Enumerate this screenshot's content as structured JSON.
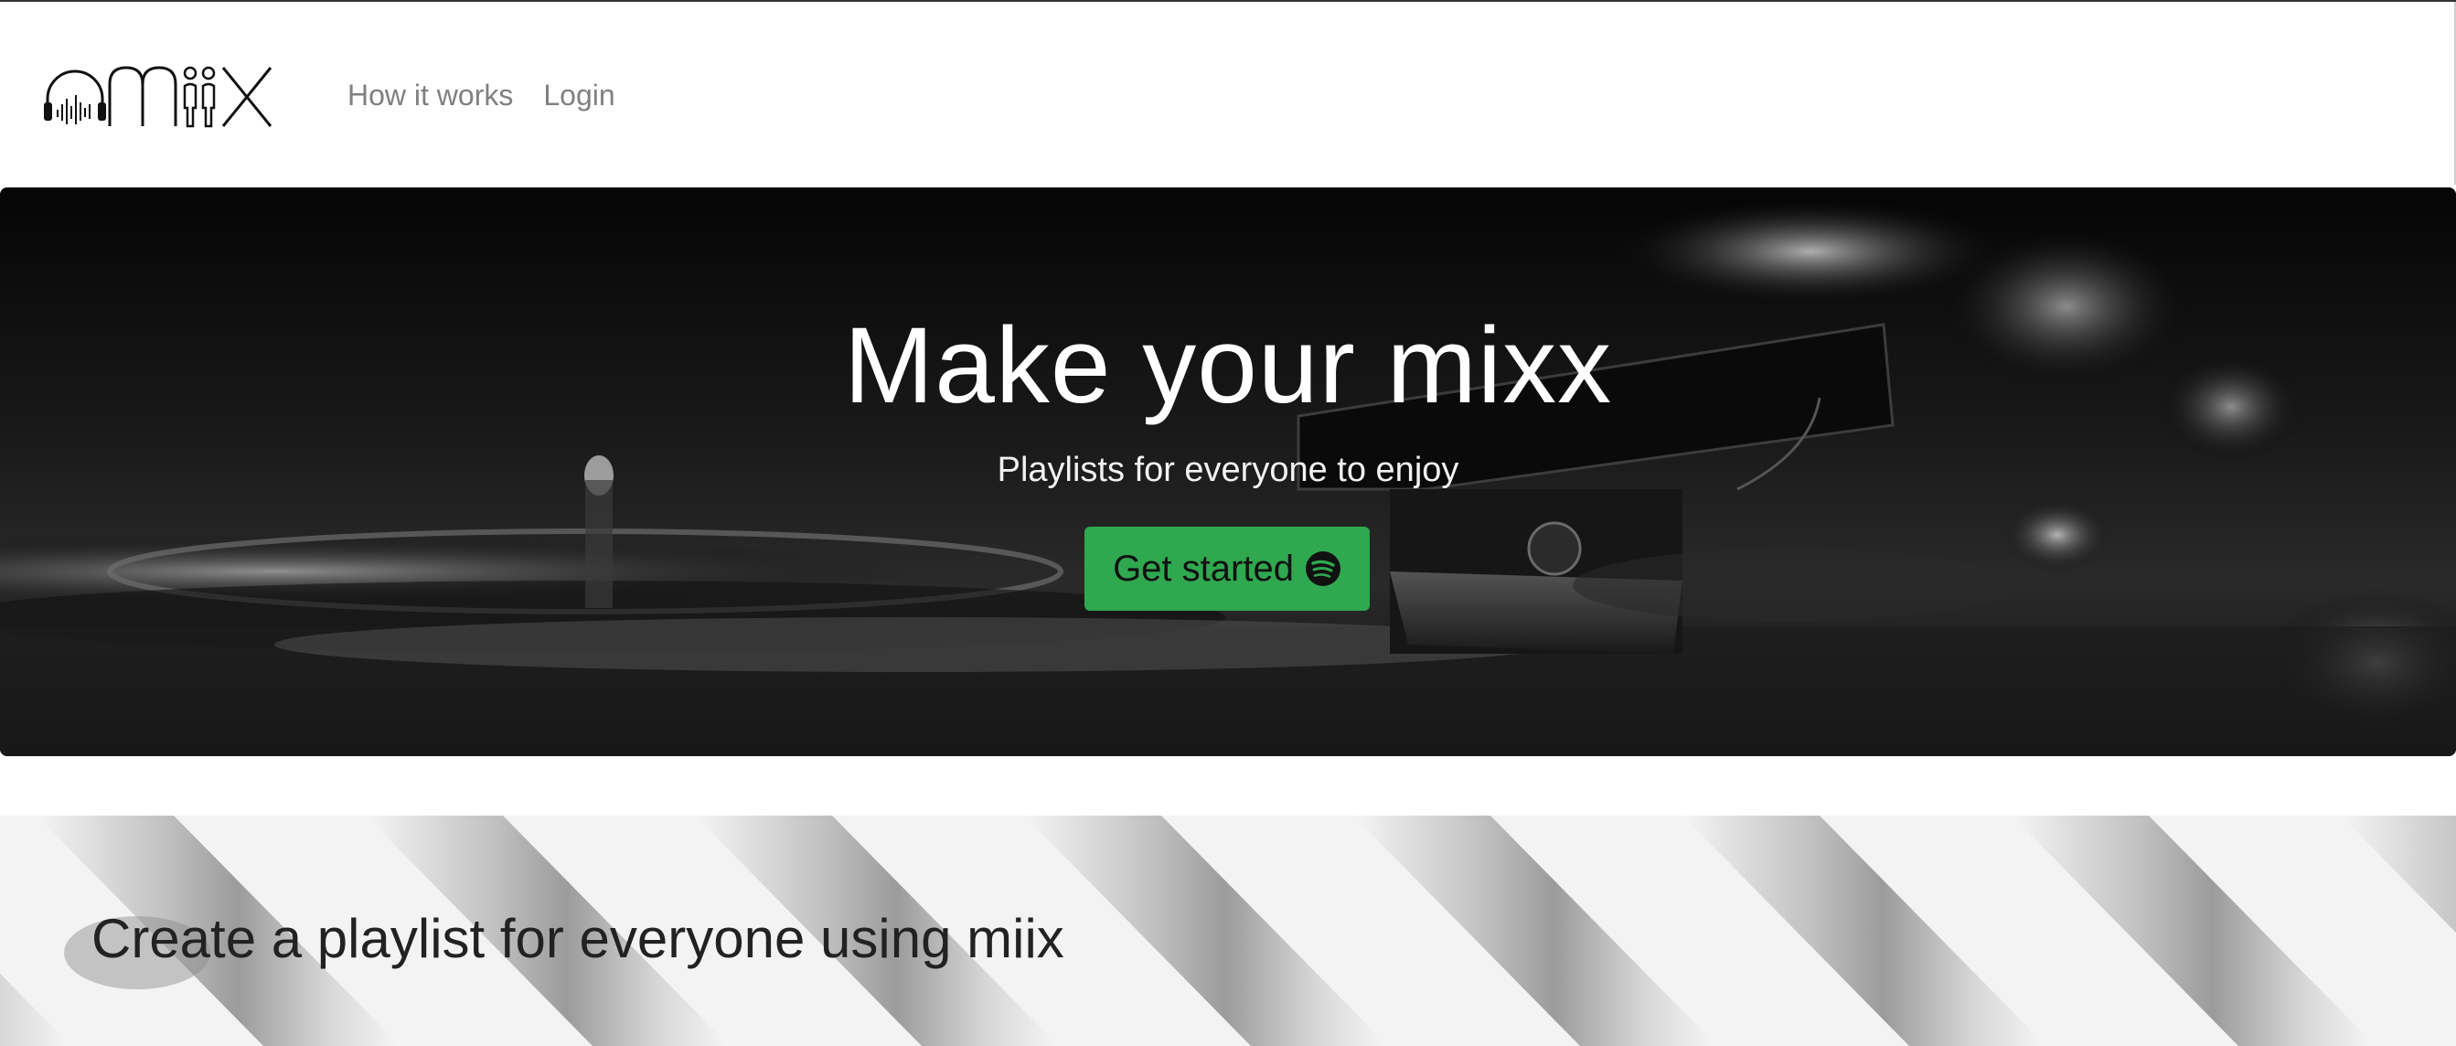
{
  "brand": {
    "name": "miix",
    "logo_icon": "headphones-logo-icon"
  },
  "nav": {
    "items": [
      {
        "label": "How it works"
      },
      {
        "label": "Login"
      }
    ]
  },
  "hero": {
    "title": "Make your mixx",
    "subtitle": "Playlists for everyone to enjoy",
    "cta_label": "Get started",
    "cta_icon": "spotify-icon",
    "cta_color": "#2fa84f"
  },
  "feature": {
    "heading": "Create a playlist for everyone using miix"
  }
}
